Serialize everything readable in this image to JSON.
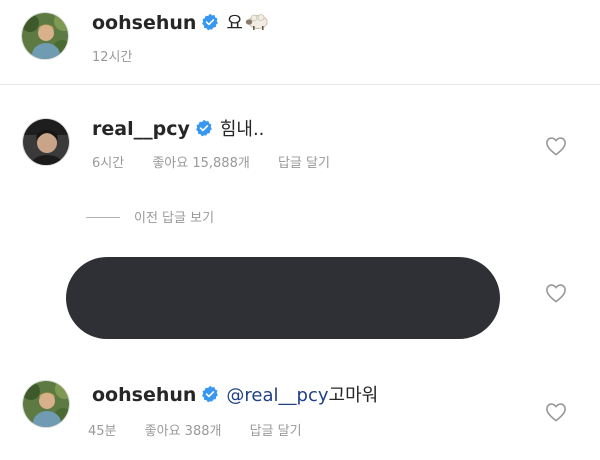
{
  "post_header": {
    "username": "oohsehun",
    "caption": "요",
    "caption_emoji": "sheep",
    "time": "12시간"
  },
  "comments": [
    {
      "username": "real__pcy",
      "text": "힘내..",
      "time": "6시간",
      "likes": "좋아요 15,888개",
      "reply": "답글 달기"
    },
    {
      "username": "oohsehun",
      "mention": "@real__pcy",
      "text": "고마워",
      "time": "45분",
      "likes": "좋아요 388개",
      "reply": "답글 달기"
    }
  ],
  "view_previous_replies": "이전 답글 보기",
  "icons": {
    "verified": "verified-badge-icon",
    "like": "heart-outline-icon"
  },
  "colors": {
    "verified_blue": "#3897f0",
    "mention_link": "#1f3f87",
    "meta_gray": "#999999",
    "redaction": "#2e3035"
  }
}
